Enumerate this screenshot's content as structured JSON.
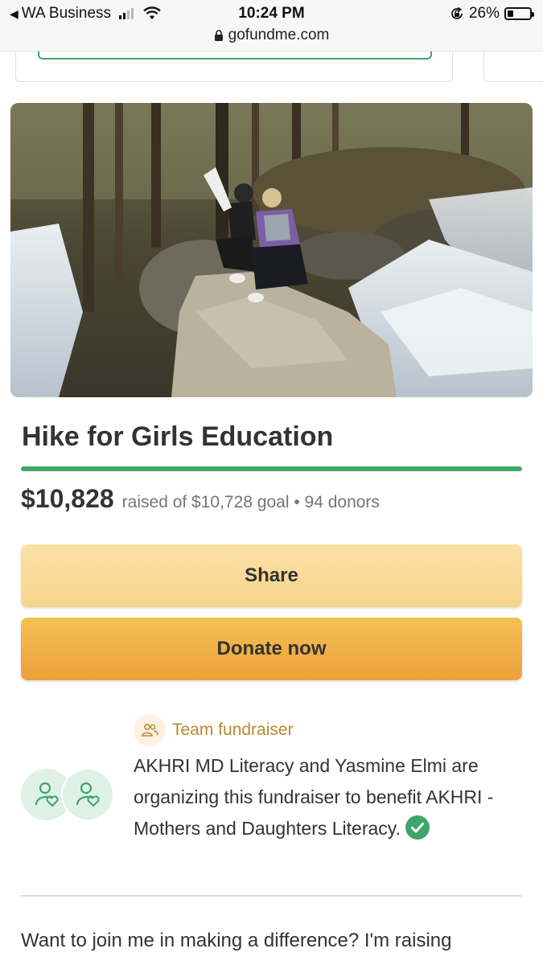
{
  "status_bar": {
    "back_app": "WA Business",
    "time": "10:24 PM",
    "battery": "26%",
    "battery_level": 0.26
  },
  "browser": {
    "url": "gofundme.com"
  },
  "campaign": {
    "title": "Hike for Girls Education",
    "amount_raised": "$10,828",
    "raised_meta": "raised of $10,728 goal • 94 donors",
    "progress_fraction": 1.0,
    "accent_color": "#3fa56a"
  },
  "actions": {
    "share_label": "Share",
    "donate_label": "Donate now"
  },
  "organizer": {
    "badge_label": "Team fundraiser",
    "description": "AKHRI MD Literacy and Yasmine Elmi are organizing this fundraiser to benefit AKHRI - Mothers and Daughters Literacy."
  },
  "story": {
    "first_line": "Want to join me in making a difference? I'm raising"
  },
  "icons": [
    "back-arrow-icon",
    "signal-icon",
    "wifi-icon",
    "rotation-lock-icon",
    "battery-icon",
    "padlock-icon",
    "team-icon",
    "person-heart-icon",
    "verified-check-icon"
  ]
}
